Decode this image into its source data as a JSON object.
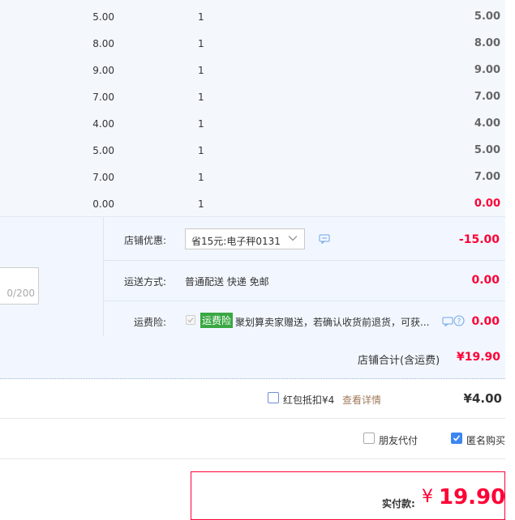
{
  "items": [
    {
      "price": "5.00",
      "qty": "1",
      "subtotal": "5.00",
      "highlight": false
    },
    {
      "price": "8.00",
      "qty": "1",
      "subtotal": "8.00",
      "highlight": false
    },
    {
      "price": "9.00",
      "qty": "1",
      "subtotal": "9.00",
      "highlight": false
    },
    {
      "price": "7.00",
      "qty": "1",
      "subtotal": "7.00",
      "highlight": false
    },
    {
      "price": "4.00",
      "qty": "1",
      "subtotal": "4.00",
      "highlight": false
    },
    {
      "price": "5.00",
      "qty": "1",
      "subtotal": "5.00",
      "highlight": false
    },
    {
      "price": "7.00",
      "qty": "1",
      "subtotal": "7.00",
      "highlight": false
    },
    {
      "price": "0.00",
      "qty": "1",
      "subtotal": "0.00",
      "highlight": true
    }
  ],
  "store_discount": {
    "label": "店铺优惠:",
    "selected": "省15元:电子秤0131",
    "amount": "-15.00"
  },
  "message": {
    "counter": "0/200"
  },
  "shipping": {
    "label": "运送方式:",
    "method": "普通配送 快递 免邮",
    "amount": "0.00"
  },
  "insurance": {
    "label": "运费险:",
    "tag": "运费险",
    "desc": "聚划算卖家赠送，若确认收货前退货，可获...",
    "amount": "0.00"
  },
  "store_total": {
    "label": "店铺合计(含运费)",
    "amount": "¥19.90"
  },
  "red_packet": {
    "label": "红包抵扣¥4",
    "link": "查看详情",
    "amount": "¥4.00"
  },
  "options": {
    "friend_pay": "朋友代付",
    "anonymous": "匿名购买"
  },
  "payment": {
    "label": "实付款:",
    "currency": "¥",
    "amount": "19.90"
  },
  "colors": {
    "accent_red": "#ff0036",
    "check_blue": "#3c86f0",
    "tag_green": "#3aa843"
  }
}
